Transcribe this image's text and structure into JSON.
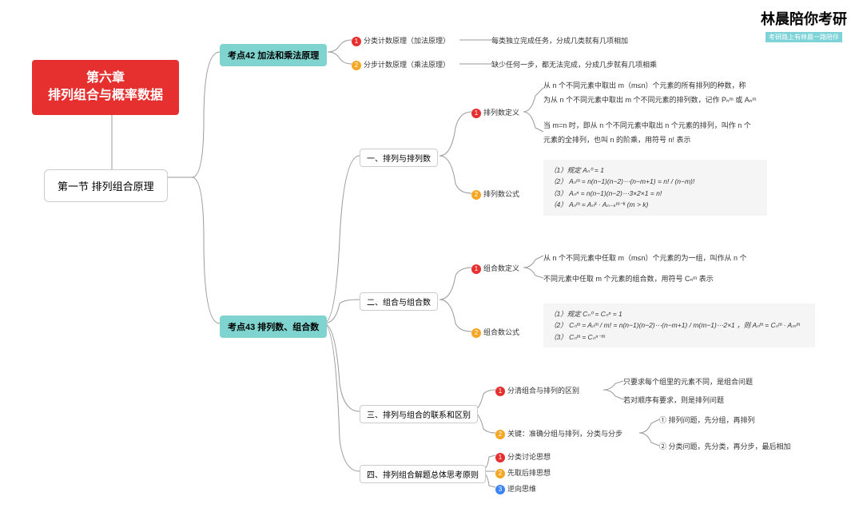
{
  "brand": {
    "main": "林晨陪你考研",
    "sub": "考研路上有林晨一路陪伴"
  },
  "root": {
    "line1": "第六章",
    "line2": "排列组合与概率数据"
  },
  "section": "第一节 排列组合原理",
  "topic42": "考点42 加法和乘法原理",
  "topic43": "考点43 排列数、组合数",
  "t42": {
    "n1": {
      "num": "1",
      "label": "分类计数原理（加法原理）",
      "desc": "每类独立完成任务，分成几类就有几项相加"
    },
    "n2": {
      "num": "2",
      "label": "分步计数原理（乘法原理）",
      "desc": "缺少任何一步，都无法完成，分成几步就有几项相乘"
    }
  },
  "t43": {
    "s1": {
      "title": "一、排列与排列数",
      "def": {
        "num": "1",
        "label": "排列数定义",
        "d1": "从 n 个不同元素中取出 m（m≤n）个元素的所有排列的种数，称",
        "d2": "为从 n 个不同元素中取出 m 个不同元素的排列数，记作 Pₙᵐ 或 Aₙᵐ",
        "d3": "当 m=n 时，即从 n 个不同元素中取出 n 个元素的排列，叫作 n 个",
        "d4": "元素的全排列，也叫 n 的阶乘，用符号 n! 表示"
      },
      "formula": {
        "num": "2",
        "label": "排列数公式",
        "f1": "（1）规定 Aₙ⁰ = 1",
        "f2": "（2） Aₙᵐ = n(n−1)(n−2)⋯(n−m+1) = n! / (n−m)!",
        "f3": "（3） Aₙⁿ = n(n−1)(n−2)⋯3×2×1 = n!",
        "f4": "（4） Aₙᵐ = Aₙᵏ · Aₙ₋ₖᵐ⁻ᵏ (m > k)"
      }
    },
    "s2": {
      "title": "二、组合与组合数",
      "def": {
        "num": "1",
        "label": "组合数定义",
        "d1": "从 n 个不同元素中任取 m（m≤n）个元素的为一组，叫作从 n 个",
        "d2": "不同元素中任取 m 个元素的组合数，用符号 Cₙᵐ 表示"
      },
      "formula": {
        "num": "2",
        "label": "组合数公式",
        "f1": "（1）规定 Cₙ⁰ = Cₙⁿ = 1",
        "f2": "（2） Cₙᵐ = Aₙᵐ / m! = n(n−1)(n−2)⋯(n−m+1) / m(m−1)⋯2×1 ，则 Aₙᵐ = Cₙᵐ · Aₘᵐ",
        "f3": "（3） Cₙᵐ = Cₙⁿ⁻ᵐ"
      }
    },
    "s3": {
      "title": "三、排列与组合的联系和区别",
      "n1": {
        "num": "1",
        "label": "分清组合与排列的区别",
        "d1": "只要求每个组里的元素不同，是组合问题",
        "d2": "若对顺序有要求，则是排列问题"
      },
      "n2": {
        "num": "2",
        "label": "关键：准确分组与排列，分类与分步",
        "d1": "① 排列问题，先分组，再排列",
        "d2": "② 分类问题，先分类，再分步，最后相加"
      }
    },
    "s4": {
      "title": "四、排列组合解题总体思考原则",
      "n1": {
        "num": "1",
        "label": "分类讨论思想"
      },
      "n2": {
        "num": "2",
        "label": "先取后排思想"
      },
      "n3": {
        "num": "3",
        "label": "逆向思维"
      }
    }
  }
}
